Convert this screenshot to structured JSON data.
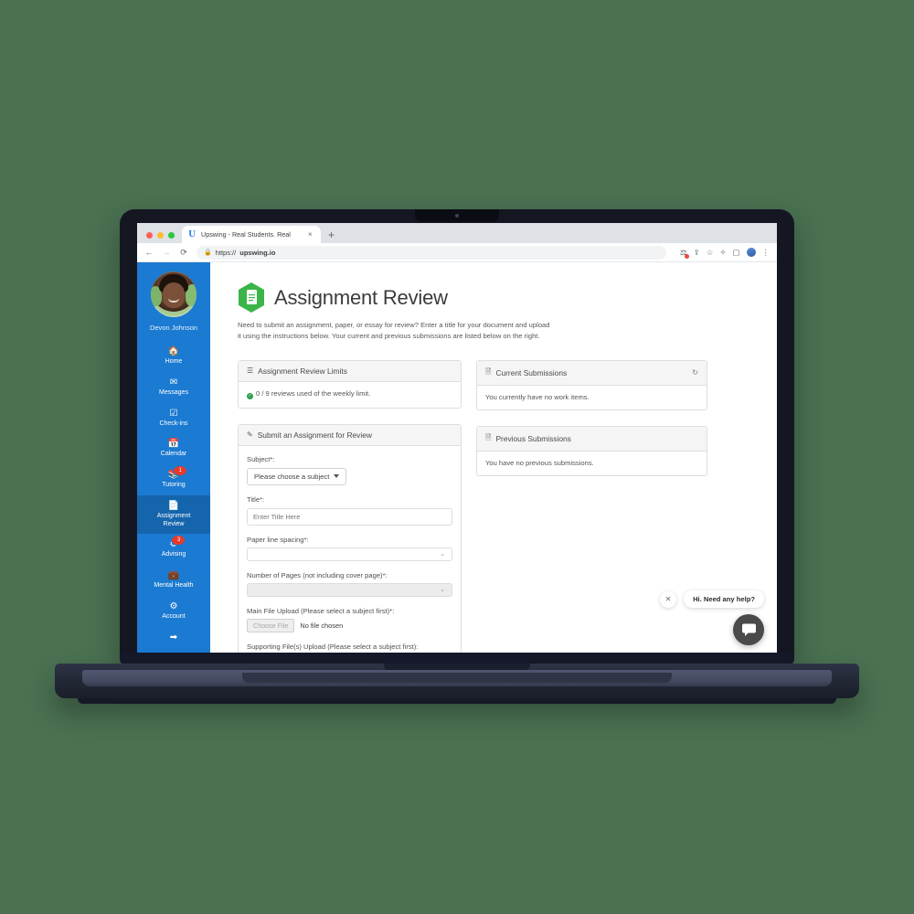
{
  "browser": {
    "tab": {
      "favicon": "upswing-favicon",
      "title": "Upswing - Real Students. Real",
      "close": "×"
    },
    "new_tab": "+",
    "nav": {
      "back": "←",
      "forward": "→",
      "reload": "⟳"
    },
    "address": {
      "lock": "🔒",
      "scheme": "https://",
      "host": "upswing.io"
    },
    "toolbar_icons": [
      "extensions-puzzle-alert-icon",
      "share-icon",
      "bookmark-star-icon",
      "puzzle-icon",
      "sidepanel-icon",
      "profile-avatar-icon",
      "kebab-menu-icon"
    ]
  },
  "sidebar": {
    "user": {
      "name": "Devon Johnson",
      "avatar": "user-avatar"
    },
    "items": [
      {
        "label": "Home",
        "icon": "home-icon",
        "badge": "",
        "active": false
      },
      {
        "label": "Messages",
        "icon": "envelope-icon",
        "badge": "",
        "active": false
      },
      {
        "label": "Check-ins",
        "icon": "check-square-icon",
        "badge": "",
        "active": false
      },
      {
        "label": "Calendar",
        "icon": "calendar-icon",
        "badge": "",
        "active": false
      },
      {
        "label": "Tutoring",
        "icon": "chalkboard-icon",
        "badge": "1",
        "active": false
      },
      {
        "label": "Assignment\nReview",
        "icon": "document-icon",
        "badge": "",
        "active": true
      },
      {
        "label": "Advising",
        "icon": "advising-icon",
        "badge": "3",
        "active": false
      },
      {
        "label": "Mental Health",
        "icon": "briefcase-medical-icon",
        "badge": "",
        "active": false
      },
      {
        "label": "Account",
        "icon": "gear-icon",
        "badge": "",
        "active": false
      },
      {
        "label": "",
        "icon": "logout-icon",
        "badge": "",
        "active": false
      }
    ]
  },
  "page": {
    "icon": "green-hex-document-icon",
    "title": "Assignment Review",
    "description": "Need to submit an assignment, paper, or essay for review? Enter a title for your document and upload it using the instructions below. Your current and previous submissions are listed below on the right."
  },
  "limits_card": {
    "icon": "list-icon",
    "title": "Assignment Review Limits",
    "status_icon": "check-circle-icon",
    "status_text": "0 / 9 reviews used of the weekly limit."
  },
  "submit_card": {
    "icon": "pencil-icon",
    "title": "Submit an Assignment for Review",
    "fields": {
      "subject_label": "Subject*:",
      "subject_value": "Please choose a subject",
      "title_label": "Title*:",
      "title_placeholder": "Enter Title Here",
      "title_value": "",
      "spacing_label": "Paper line spacing*:",
      "spacing_value": "",
      "pages_label": "Number of Pages (not including cover page)*:",
      "pages_value": "",
      "main_file_label": "Main File Upload (Please select a subject first)*:",
      "choose_file_button": "Choose File",
      "no_file_text": "No file chosen",
      "supporting_files_label": "Supporting File(s) Upload (Please select a subject first):"
    }
  },
  "current_card": {
    "icon": "file-icon",
    "title": "Current Submissions",
    "refresh_icon": "refresh-icon",
    "body": "You currently have no work items."
  },
  "previous_card": {
    "icon": "file-icon",
    "title": "Previous Submissions",
    "body": "You have no previous submissions."
  },
  "chat": {
    "close_icon": "close-icon",
    "prompt": "Hi. Need any help?",
    "fab_icon": "chat-bubble-icon"
  },
  "colors": {
    "background": "#4a7152",
    "sidebar": "#1b7ad1",
    "sidebar_active": "#1565ad",
    "brand_green": "#3bb54a",
    "badge_red": "#e8392d"
  }
}
